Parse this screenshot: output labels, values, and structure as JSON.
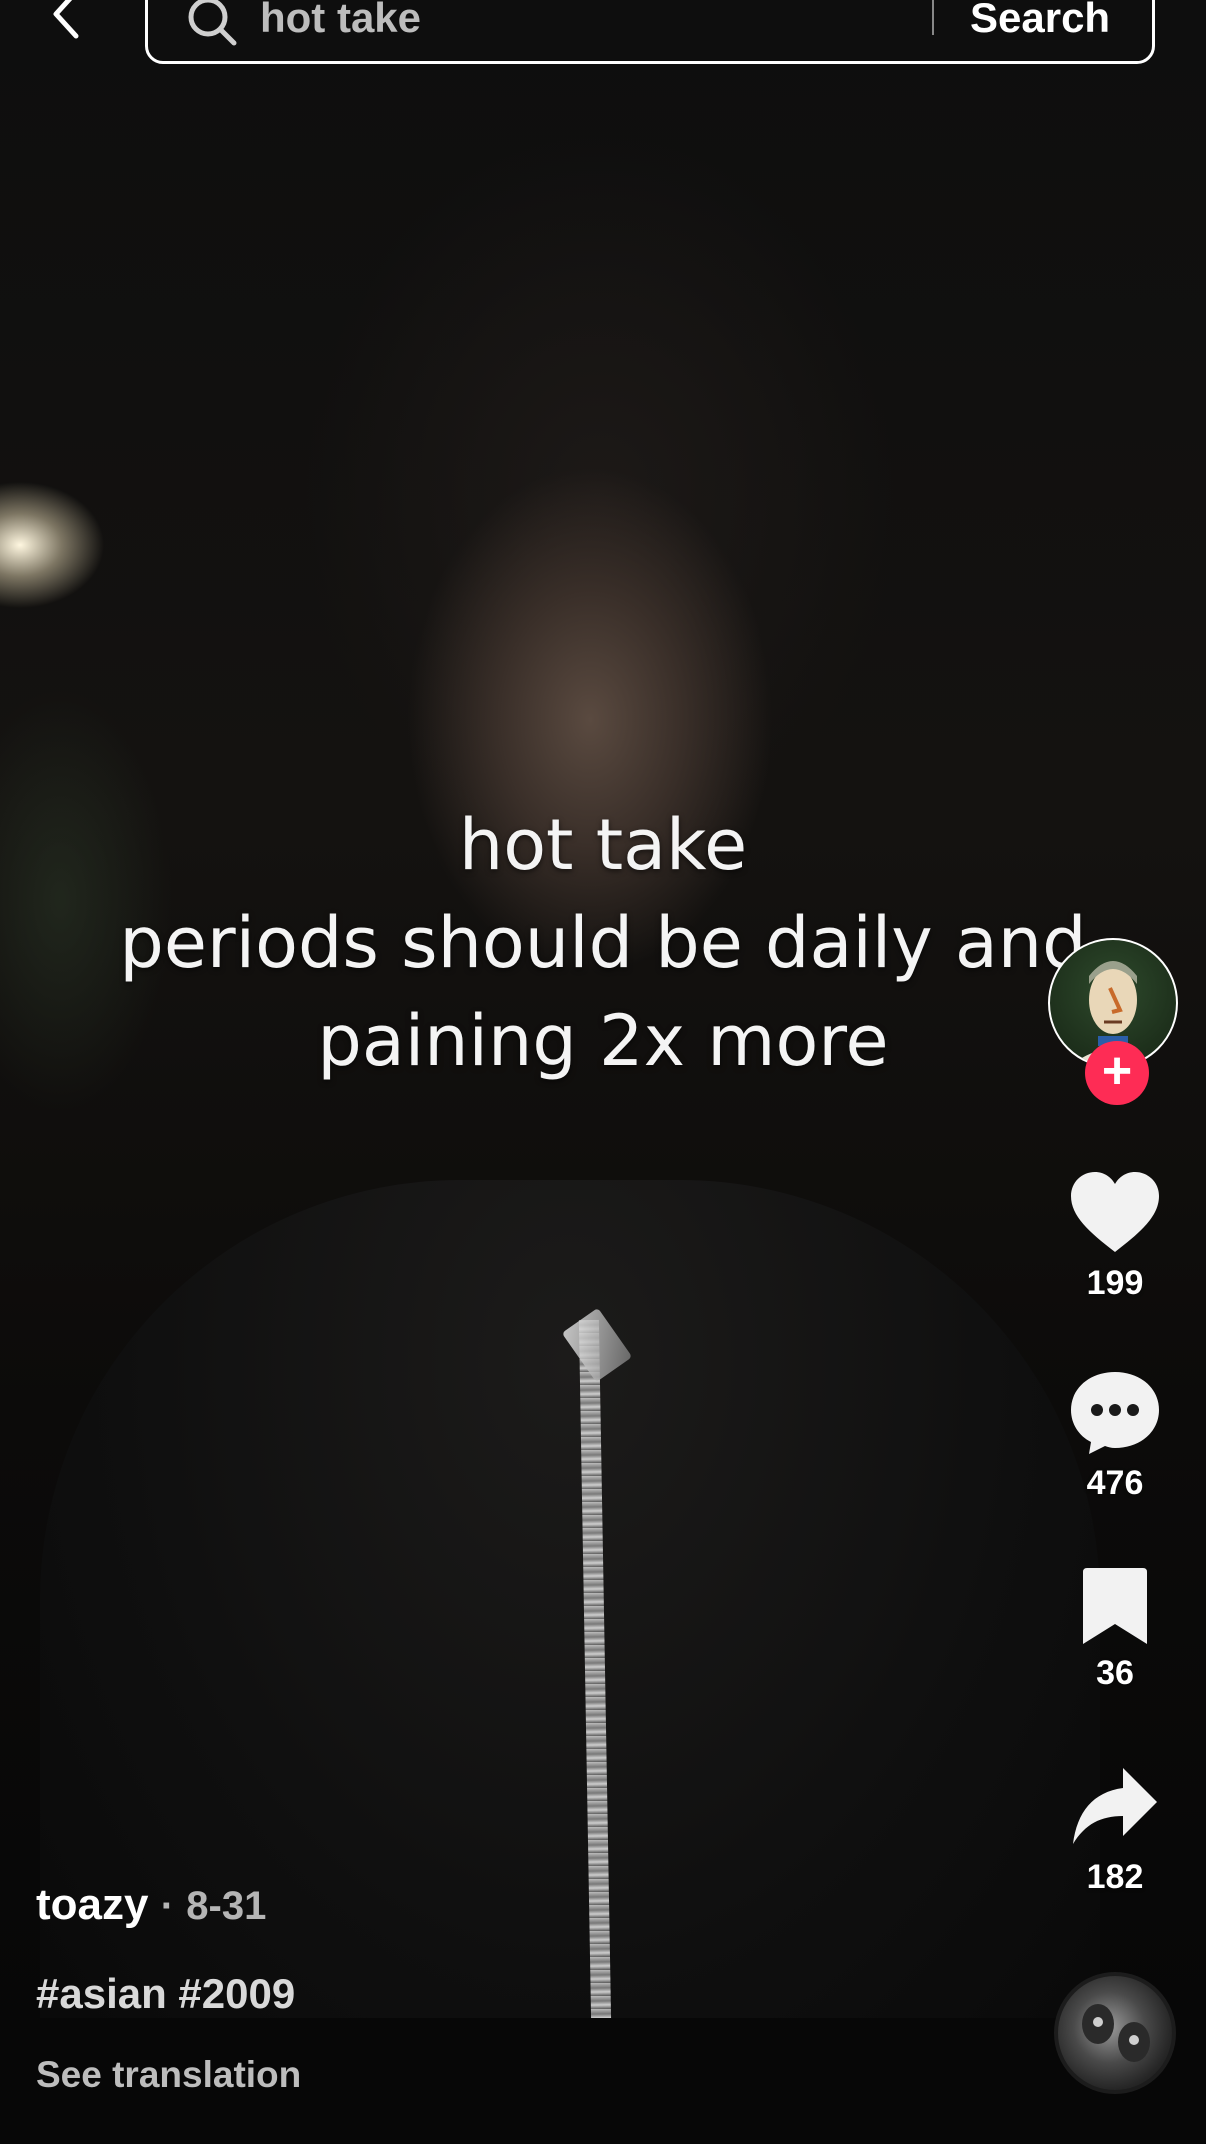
{
  "search": {
    "query": "hot take",
    "button_label": "Search"
  },
  "video": {
    "overlay_lines": [
      "hot take",
      "periods should be daily and",
      "paining 2x more"
    ]
  },
  "actions": {
    "likes": "199",
    "comments": "476",
    "saves": "36",
    "shares": "182"
  },
  "post": {
    "author": "toazy",
    "date_separator": "·",
    "date": "8-31",
    "hashtags": "#asian #2009",
    "see_translation": "See translation"
  },
  "icons": {
    "back": "chevron-left-icon",
    "search": "search-icon",
    "follow": "plus-icon",
    "like": "heart-icon",
    "comment": "comment-bubble-icon",
    "save": "bookmark-icon",
    "share": "share-arrow-icon"
  },
  "colors": {
    "follow_accent": "#fe2c55",
    "text_primary": "#ffffff",
    "text_secondary": "#bdbdbd"
  }
}
